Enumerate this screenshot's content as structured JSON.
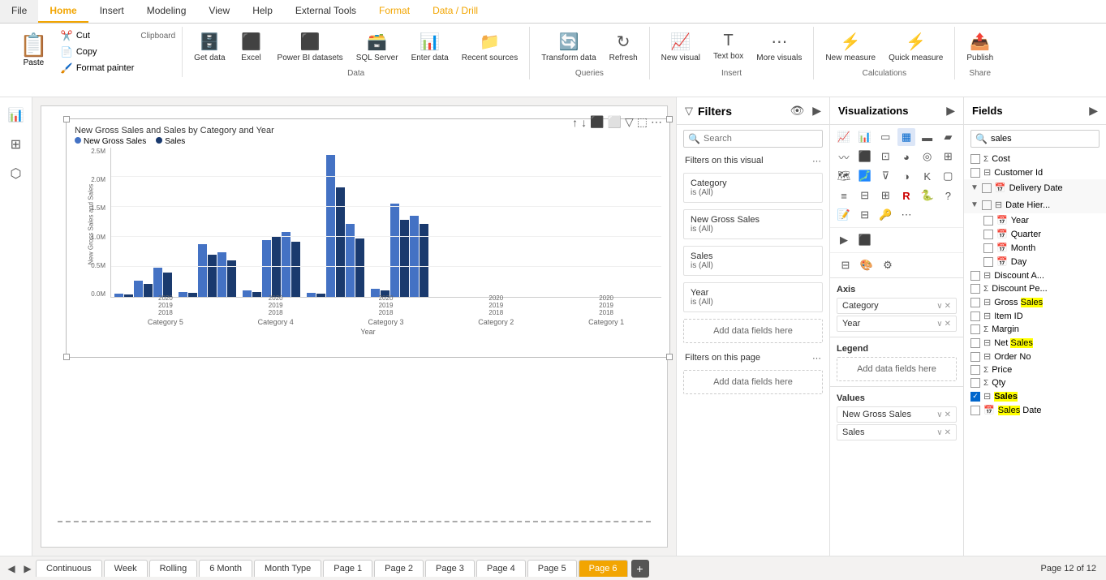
{
  "ribbon": {
    "tabs": [
      {
        "id": "file",
        "label": "File",
        "active": false
      },
      {
        "id": "home",
        "label": "Home",
        "active": true
      },
      {
        "id": "insert",
        "label": "Insert",
        "active": false
      },
      {
        "id": "modeling",
        "label": "Modeling",
        "active": false
      },
      {
        "id": "view",
        "label": "View",
        "active": false
      },
      {
        "id": "help",
        "label": "Help",
        "active": false
      },
      {
        "id": "external-tools",
        "label": "External Tools",
        "active": false
      },
      {
        "id": "format",
        "label": "Format",
        "active": false,
        "colored": true
      },
      {
        "id": "data-drill",
        "label": "Data / Drill",
        "active": false,
        "colored": true
      }
    ],
    "clipboard": {
      "label": "Clipboard",
      "paste_label": "Paste",
      "cut_label": "Cut",
      "copy_label": "Copy",
      "format_painter_label": "Format painter"
    },
    "data_group": {
      "label": "Data",
      "get_data_label": "Get data",
      "excel_label": "Excel",
      "power_bi_datasets_label": "Power BI datasets",
      "sql_server_label": "SQL Server",
      "enter_data_label": "Enter data",
      "recent_sources_label": "Recent sources"
    },
    "queries_group": {
      "label": "Queries",
      "transform_data_label": "Transform data",
      "refresh_label": "Refresh"
    },
    "insert_group": {
      "label": "Insert",
      "new_visual_label": "New visual",
      "text_box_label": "Text box",
      "more_visuals_label": "More visuals"
    },
    "calculations_group": {
      "label": "Calculations",
      "new_measure_label": "New measure",
      "quick_measure_label": "Quick measure"
    },
    "share_group": {
      "label": "Share",
      "publish_label": "Publish"
    }
  },
  "filters": {
    "title": "Filters",
    "search_placeholder": "Search",
    "on_this_visual_label": "Filters on this visual",
    "on_this_page_label": "Filters on this page",
    "cards": [
      {
        "title": "Category",
        "sub": "is (All)"
      },
      {
        "title": "New Gross Sales",
        "sub": "is (All)"
      },
      {
        "title": "Sales",
        "sub": "is (All)"
      },
      {
        "title": "Year",
        "sub": "is (All)"
      }
    ],
    "add_field_label": "Add data fields here",
    "add_field_page_label": "Add data fields here"
  },
  "visualizations": {
    "title": "Visualizations",
    "axis_label": "Axis",
    "axis_fields": [
      {
        "name": "Category"
      },
      {
        "name": "Year"
      }
    ],
    "legend_label": "Legend",
    "legend_placeholder": "Add data fields here",
    "values_label": "Values",
    "values_fields": [
      {
        "name": "New Gross Sales"
      },
      {
        "name": "Sales"
      }
    ]
  },
  "fields": {
    "title": "Fields",
    "search_placeholder": "sales",
    "items": [
      {
        "name": "Cost",
        "type": "sigma",
        "checked": false,
        "highlight": false
      },
      {
        "name": "Customer Id",
        "type": "table",
        "checked": false,
        "highlight": false
      },
      {
        "name": "Delivery Date",
        "type": "calendar",
        "checked": false,
        "highlight": false
      },
      {
        "name": "Date Hier...",
        "type": "hierarchy",
        "checked": false,
        "highlight": false,
        "expanded": true
      },
      {
        "name": "Year",
        "type": "calendar-sub",
        "checked": false,
        "highlight": false
      },
      {
        "name": "Quarter",
        "type": "calendar-sub",
        "checked": false,
        "highlight": false
      },
      {
        "name": "Month",
        "type": "calendar-sub",
        "checked": false,
        "highlight": false
      },
      {
        "name": "Day",
        "type": "calendar-sub",
        "checked": false,
        "highlight": false
      },
      {
        "name": "Discount A...",
        "type": "table",
        "checked": false,
        "highlight": false
      },
      {
        "name": "Discount Pe...",
        "type": "sigma",
        "checked": false,
        "highlight": false
      },
      {
        "name": "Gross Sales",
        "type": "table",
        "checked": false,
        "highlight": true
      },
      {
        "name": "Item ID",
        "type": "table",
        "checked": false,
        "highlight": false
      },
      {
        "name": "Margin",
        "type": "sigma",
        "checked": false,
        "highlight": false
      },
      {
        "name": "Net Sales",
        "type": "table",
        "checked": false,
        "highlight": true
      },
      {
        "name": "Order No",
        "type": "table",
        "checked": false,
        "highlight": false
      },
      {
        "name": "Price",
        "type": "sigma",
        "checked": false,
        "highlight": false
      },
      {
        "name": "Qty",
        "type": "sigma",
        "checked": false,
        "highlight": false
      },
      {
        "name": "Sales",
        "type": "table",
        "checked": true,
        "highlight": true
      },
      {
        "name": "Sales Date",
        "type": "calendar",
        "checked": false,
        "highlight": true
      }
    ]
  },
  "chart": {
    "title": "New Gross Sales and Sales by Category and Year",
    "legend": [
      {
        "color": "#4472c4",
        "label": "New Gross Sales"
      },
      {
        "color": "#1a3a6e",
        "label": "Sales"
      }
    ],
    "y_labels": [
      "2.5M",
      "2.0M",
      "1.5M",
      "1.0M",
      "0.5M",
      "0.0M"
    ],
    "x_axis_label": "Year",
    "y_axis_label": "New Gross Sales and Sales"
  },
  "page_tabs": {
    "nav_prev": "<",
    "nav_next": ">",
    "tabs": [
      {
        "label": "Continuous",
        "active": false
      },
      {
        "label": "Week",
        "active": false
      },
      {
        "label": "Rolling",
        "active": false
      },
      {
        "label": "6 Month",
        "active": false
      },
      {
        "label": "Month Type",
        "active": false
      },
      {
        "label": "Page 1",
        "active": false
      },
      {
        "label": "Page 2",
        "active": false
      },
      {
        "label": "Page 3",
        "active": false
      },
      {
        "label": "Page 4",
        "active": false
      },
      {
        "label": "Page 5",
        "active": false
      },
      {
        "label": "Page 6",
        "active": true
      }
    ],
    "add_label": "+",
    "page_info": "Page 12 of 12"
  }
}
